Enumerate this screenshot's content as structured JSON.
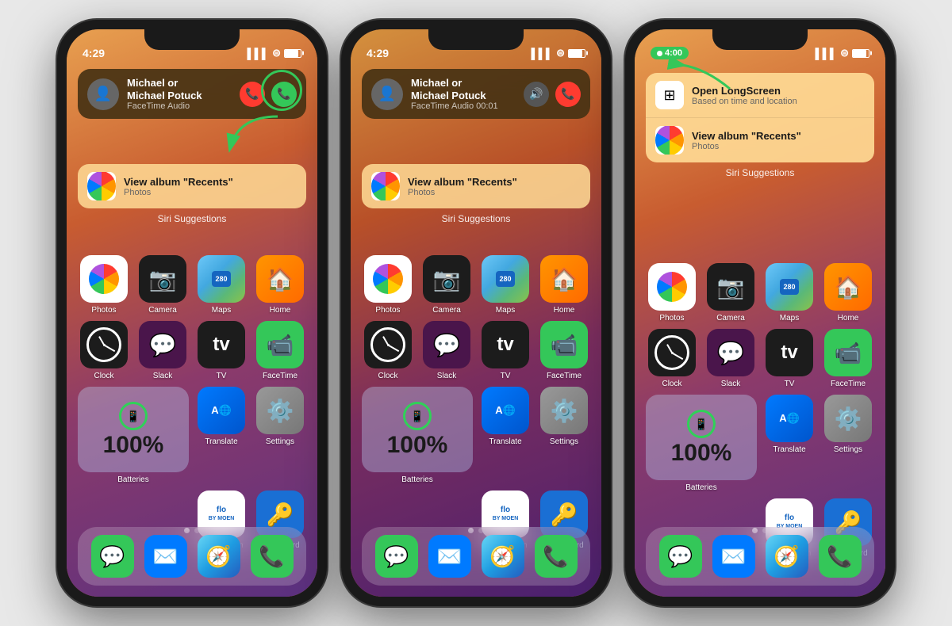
{
  "phones": [
    {
      "id": "phone1",
      "statusBar": {
        "time": "4:29",
        "signalBars": "▌▌▌",
        "wifi": "wifi",
        "battery": 100
      },
      "notification": {
        "contact": "Michael or\nMichael Potuck",
        "subtitle": "FaceTime Audio",
        "hasDecline": true,
        "hasAccept": true,
        "hasSpeaker": false,
        "showTimer": false
      },
      "siriSuggestions": {
        "label": "Siri Suggestions",
        "items": [
          {
            "title": "View album \"Recents\"",
            "subtitle": "Photos",
            "icon": "photos"
          }
        ]
      },
      "apps": [
        {
          "name": "Photos",
          "icon": "photos"
        },
        {
          "name": "Camera",
          "icon": "camera"
        },
        {
          "name": "Maps",
          "icon": "maps"
        },
        {
          "name": "Home",
          "icon": "home"
        },
        {
          "name": "Clock",
          "icon": "clock"
        },
        {
          "name": "Slack",
          "icon": "slack"
        },
        {
          "name": "TV",
          "icon": "tv"
        },
        {
          "name": "FaceTime",
          "icon": "facetime"
        },
        {
          "name": "Batteries",
          "icon": "battery-widget",
          "widget": true
        },
        {
          "name": "Translate",
          "icon": "translate"
        },
        {
          "name": "Settings",
          "icon": "settings"
        },
        {
          "name": "Flo by Moen",
          "icon": "flo"
        },
        {
          "name": "1Password",
          "icon": "onepassword"
        }
      ],
      "dock": [
        "Messages",
        "Mail",
        "Safari",
        "Phone"
      ],
      "dots": [
        true,
        false
      ],
      "hasGreenCircle": true,
      "hasArrow": true
    },
    {
      "id": "phone2",
      "statusBar": {
        "time": "4:29",
        "signalBars": "▌▌▌",
        "wifi": "wifi",
        "battery": 100
      },
      "notification": {
        "contact": "Michael or\nMichael Potuck",
        "subtitle": "FaceTime Audio 00:01",
        "hasDecline": true,
        "hasAccept": false,
        "hasSpeaker": true,
        "showTimer": false
      },
      "siriSuggestions": {
        "label": "Siri Suggestions",
        "items": [
          {
            "title": "View album \"Recents\"",
            "subtitle": "Photos",
            "icon": "photos"
          }
        ]
      },
      "apps": [
        {
          "name": "Photos",
          "icon": "photos"
        },
        {
          "name": "Camera",
          "icon": "camera"
        },
        {
          "name": "Maps",
          "icon": "maps"
        },
        {
          "name": "Home",
          "icon": "home"
        },
        {
          "name": "Clock",
          "icon": "clock"
        },
        {
          "name": "Slack",
          "icon": "slack"
        },
        {
          "name": "TV",
          "icon": "tv"
        },
        {
          "name": "FaceTime",
          "icon": "facetime"
        },
        {
          "name": "Batteries",
          "icon": "battery-widget",
          "widget": true
        },
        {
          "name": "Translate",
          "icon": "translate"
        },
        {
          "name": "Settings",
          "icon": "settings"
        },
        {
          "name": "Flo by Moen",
          "icon": "flo"
        },
        {
          "name": "1Password",
          "icon": "onepassword"
        }
      ],
      "dock": [
        "Messages",
        "Mail",
        "Safari",
        "Phone"
      ],
      "dots": [
        true,
        false
      ],
      "hasGreenCircle": false,
      "hasArrow": false
    },
    {
      "id": "phone3",
      "statusBar": {
        "time": "4:00",
        "signalBars": "▌▌▌",
        "wifi": "wifi",
        "battery": 100,
        "callIndicator": true,
        "callTime": "4:00"
      },
      "siriSuggestions": {
        "label": "Siri Suggestions",
        "items": [
          {
            "title": "Open LongScreen",
            "subtitle": "Based on time and location",
            "icon": "longscreen"
          },
          {
            "title": "View album \"Recents\"",
            "subtitle": "Photos",
            "icon": "photos"
          }
        ]
      },
      "apps": [
        {
          "name": "Photos",
          "icon": "photos"
        },
        {
          "name": "Camera",
          "icon": "camera"
        },
        {
          "name": "Maps",
          "icon": "maps"
        },
        {
          "name": "Home",
          "icon": "home"
        },
        {
          "name": "Clock",
          "icon": "clock"
        },
        {
          "name": "Slack",
          "icon": "slack"
        },
        {
          "name": "TV",
          "icon": "tv"
        },
        {
          "name": "FaceTime",
          "icon": "facetime"
        },
        {
          "name": "Batteries",
          "icon": "battery-widget",
          "widget": true
        },
        {
          "name": "Translate",
          "icon": "translate"
        },
        {
          "name": "Settings",
          "icon": "settings"
        },
        {
          "name": "Flo by Moen",
          "icon": "flo"
        },
        {
          "name": "1Password",
          "icon": "onepassword"
        }
      ],
      "dock": [
        "Messages",
        "Mail",
        "Safari",
        "Phone"
      ],
      "dots": [
        true,
        false
      ],
      "hasGreenCircle": false,
      "hasArrow": true,
      "arrowFromTop": true
    }
  ],
  "labels": {
    "siriSuggestions": "Siri Suggestions",
    "batteries": "Batteries",
    "battery100": "100%",
    "floByMoen": "Flo by Moen",
    "onePassword": "1Password",
    "translate": "Translate",
    "settings": "Settings",
    "clock": "Clock",
    "slack": "Slack",
    "tv": "TV",
    "facetime": "FaceTime",
    "photos": "Photos",
    "camera": "Camera",
    "maps": "Maps",
    "home": "Home",
    "messages": "Messages",
    "mail": "Mail",
    "safari": "Safari",
    "phone": "Phone",
    "openLongScreen": "Open LongScreen",
    "basedOnTime": "Based on time and location",
    "viewAlbum": "View album \"Recents\"",
    "photosApp": "Photos"
  }
}
